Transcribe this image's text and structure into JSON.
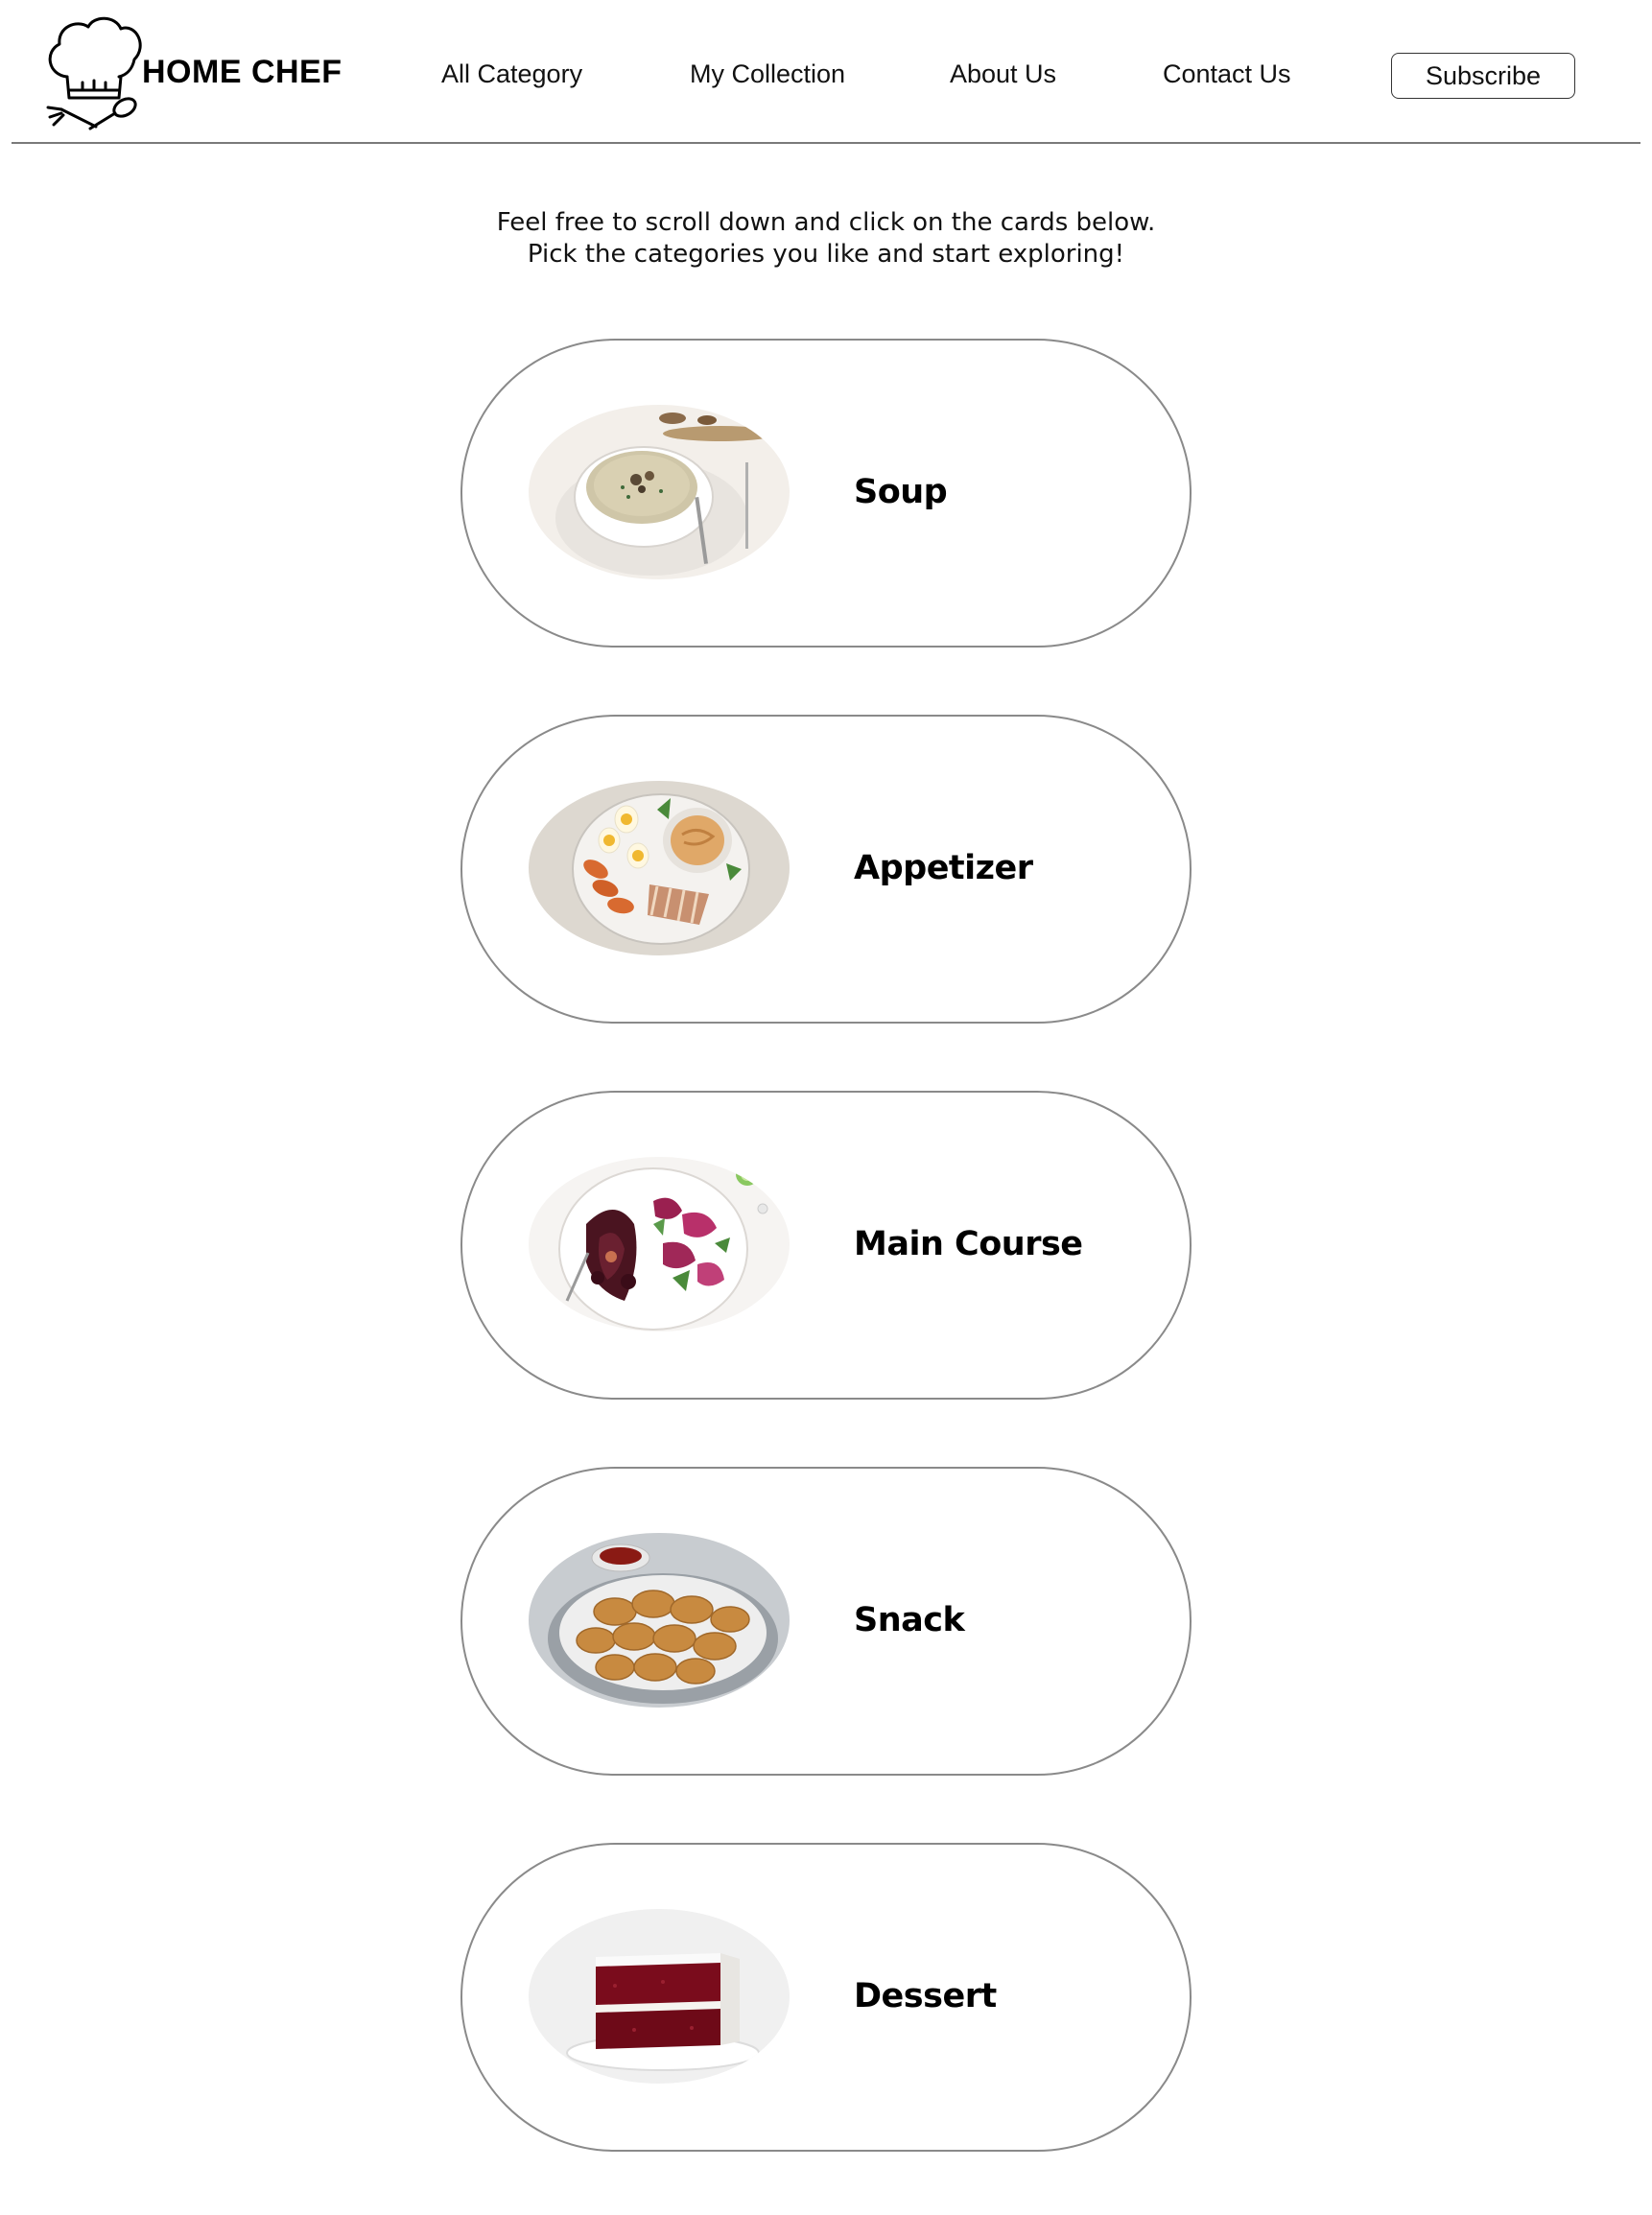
{
  "brand": {
    "name": "HOME CHEF",
    "icon": "chef-hat-icon"
  },
  "nav": {
    "items": [
      {
        "label": "All Category"
      },
      {
        "label": "My Collection"
      },
      {
        "label": "About Us"
      },
      {
        "label": "Contact Us"
      }
    ],
    "subscribe_label": "Subscribe"
  },
  "intro": {
    "line1": "Feel free to scroll down and click on the cards below.",
    "line2": "Pick the categories you like and start exploring!"
  },
  "categories": [
    {
      "label": "Soup",
      "image": "mushroom-soup-bowl"
    },
    {
      "label": "Appetizer",
      "image": "egg-chicken-dip-plate"
    },
    {
      "label": "Main Course",
      "image": "glazed-chicken-salad-plate"
    },
    {
      "label": "Snack",
      "image": "chicken-nuggets-basket"
    },
    {
      "label": "Dessert",
      "image": "red-velvet-cake-slice"
    }
  ],
  "colors": {
    "border": "#8a8a8a",
    "divider": "#7a7a7a",
    "text": "#000000",
    "background": "#ffffff"
  }
}
